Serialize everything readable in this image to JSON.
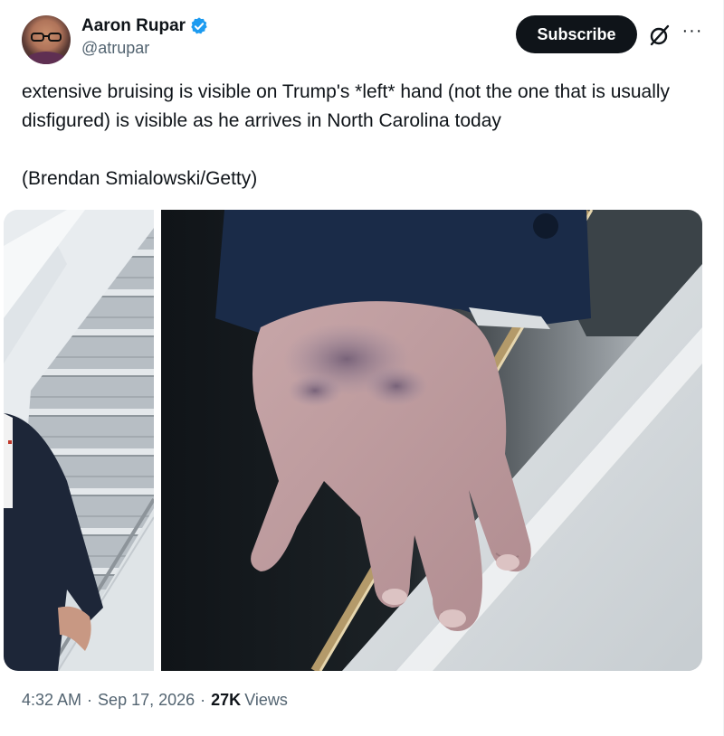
{
  "author": {
    "display_name": "Aaron Rupar",
    "handle": "@atrupar",
    "verified": true
  },
  "actions": {
    "subscribe_label": "Subscribe",
    "grok_icon": "grok-slash-icon",
    "more_icon": "more-horizontal-icon",
    "more_glyph": "···"
  },
  "tweet": {
    "text": "extensive bruising is visible on Trump's *left* hand (not the one that is usually disfigured) is visible as he arrives in North Carolina today",
    "credit": "(Brendan Smialowski/Getty)"
  },
  "media": {
    "count": 2
  },
  "meta": {
    "time": "4:32 AM",
    "separator": "·",
    "date": "Sep 17, 2026",
    "views_count": "27K",
    "views_label": "Views"
  },
  "colors": {
    "text_primary": "#0f1419",
    "text_secondary": "#536471",
    "verified_blue": "#1d9bf0",
    "button_bg": "#0f1419"
  }
}
